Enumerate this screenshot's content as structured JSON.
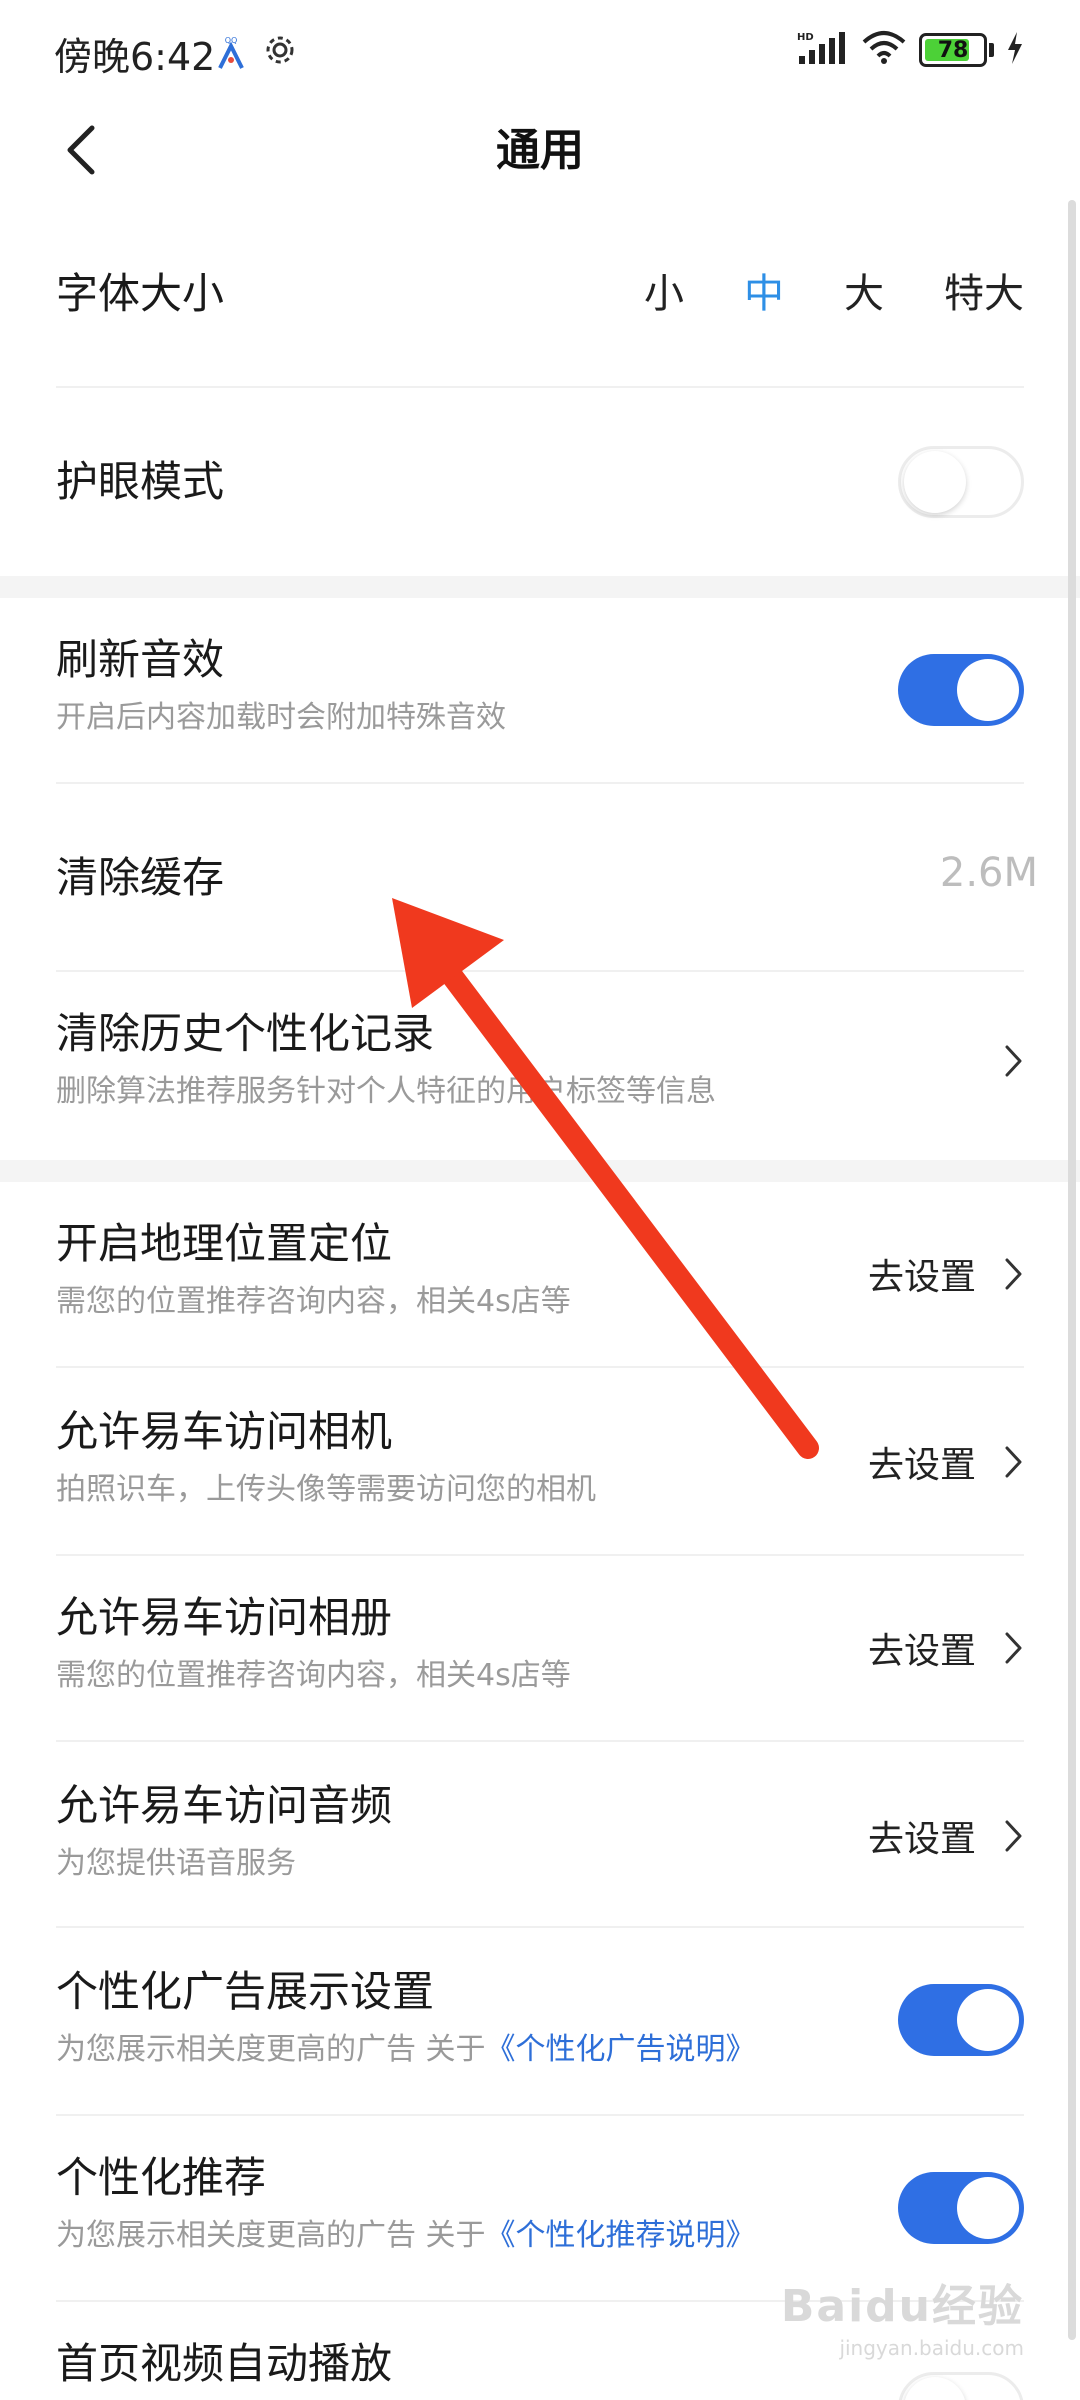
{
  "status_bar": {
    "time": "傍晚6:42",
    "network": "HD",
    "battery": "78"
  },
  "header": {
    "title": "通用"
  },
  "font_size": {
    "label": "字体大小",
    "options": [
      "小",
      "中",
      "大",
      "特大"
    ],
    "selected": "中"
  },
  "eye_mode": {
    "label": "护眼模式",
    "toggle": "off"
  },
  "refresh_sound": {
    "label": "刷新音效",
    "desc": "开启后内容加载时会附加特殊音效",
    "toggle": "on"
  },
  "clear_cache": {
    "label": "清除缓存",
    "value": "2.6M"
  },
  "clear_history": {
    "label": "清除历史个性化记录",
    "desc": "删除算法推荐服务针对个人特征的用户标签等信息"
  },
  "permissions": [
    {
      "label": "开启地理位置定位",
      "desc": "需您的位置推荐咨询内容，相关4s店等",
      "action": "去设置"
    },
    {
      "label": "允许易车访问相机",
      "desc": "拍照识车，上传头像等需要访问您的相机",
      "action": "去设置"
    },
    {
      "label": "允许易车访问相册",
      "desc": "需您的位置推荐咨询内容，相关4s店等",
      "action": "去设置"
    },
    {
      "label": "允许易车访问音频",
      "desc": "为您提供语音服务",
      "action": "去设置"
    }
  ],
  "personalized_ads": {
    "label": "个性化广告展示设置",
    "desc_prefix": "为您展示相关度更高的广告 关于",
    "link": "《个性化广告说明》",
    "toggle": "on"
  },
  "personalized_rec": {
    "label": "个性化推荐",
    "desc_prefix": "为您展示相关度更高的广告 关于",
    "link": "《个性化推荐说明》",
    "toggle": "on"
  },
  "autoplay": {
    "label": "首页视频自动播放"
  },
  "watermark": {
    "main": "Baidu经验",
    "sub": "jingyan.baidu.com"
  },
  "colors": {
    "accent": "#2f6fe4",
    "selected_text": "#2e8fe6",
    "annotation_arrow": "#f0391e"
  }
}
